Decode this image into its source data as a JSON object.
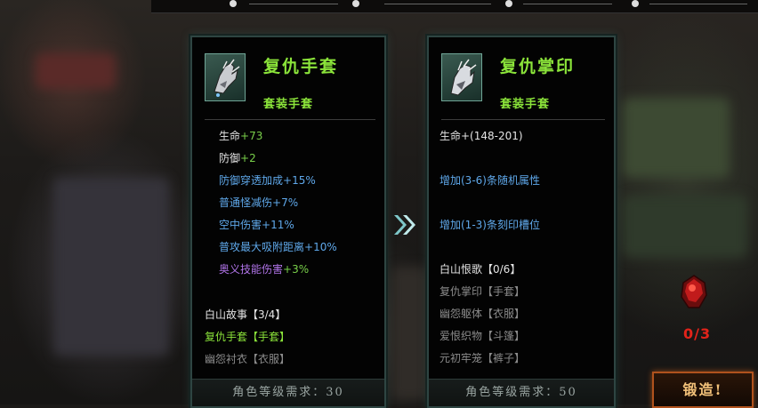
{
  "left_item": {
    "name": "复仇手套",
    "type": "套装手套",
    "stats": [
      {
        "text": "生命",
        "bonus": "+73"
      },
      {
        "text": "防御",
        "bonus": "+2"
      },
      {
        "text": "防御穿透加成",
        "bonus": "+15%"
      },
      {
        "text": "普通怪减伤",
        "bonus": "+7%"
      },
      {
        "text": "空中伤害",
        "bonus": "+11%"
      },
      {
        "text": "普攻最大吸附距离",
        "bonus": "+10%"
      },
      {
        "text": "奥义技能伤害",
        "bonus": "+3%"
      }
    ],
    "set_name": "白山故事【3/4】",
    "set_items": [
      "复仇手套【手套】",
      "幽怨衬衣【衣服】"
    ],
    "requirement": "角色等级需求：30"
  },
  "right_item": {
    "name": "复仇掌印",
    "type": "套装手套",
    "stat_hp": "生命+(148-201)",
    "random_attr": "增加(3-6)条随机属性",
    "engrave_slot": "增加(1-3)条刻印槽位",
    "set_name": "白山恨歌【0/6】",
    "set_items": [
      "复仇掌印【手套】",
      "幽怨躯体【衣服】",
      "爱恨织物【斗篷】",
      "元初牢笼【裤子】"
    ],
    "requirement": "角色等级需求：50"
  },
  "material_count": "0/3",
  "forge_label": "锻造!"
}
